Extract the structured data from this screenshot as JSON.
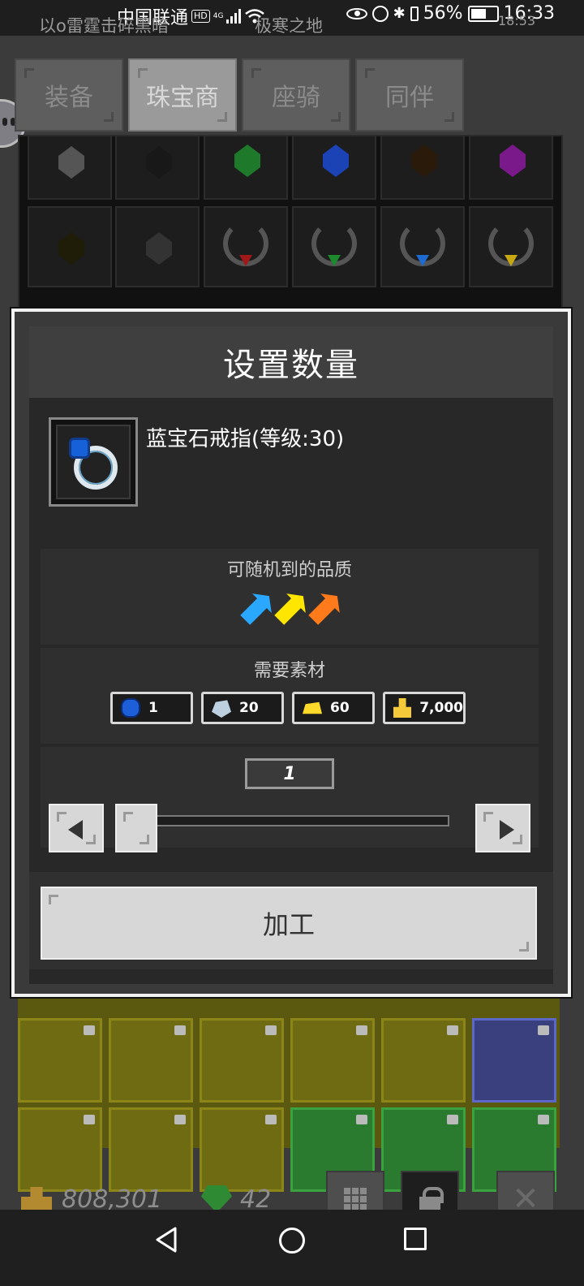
{
  "status_bar": {
    "carrier": "中国联通",
    "hd": "HD",
    "network": "4G",
    "battery": "56%",
    "time": "16:33"
  },
  "background_header": {
    "left_text": "以o雷霆击碎黑暗",
    "mid_text": "极寒之地",
    "right_text": "18:53"
  },
  "tabs": [
    {
      "label": "装备"
    },
    {
      "label": "珠宝商"
    },
    {
      "label": "座骑"
    },
    {
      "label": "同伴"
    }
  ],
  "dialog": {
    "title": "设置数量",
    "item_name": "蓝宝石戒指(等级:30)",
    "quality_title": "可随机到的品质",
    "qualities": [
      "blue-feather-icon",
      "yellow-feather-icon",
      "orange-feather-icon"
    ],
    "materials_title": "需要素材",
    "materials": [
      {
        "icon": "sapphire-icon",
        "amount": "1"
      },
      {
        "icon": "silver-ore-icon",
        "amount": "20"
      },
      {
        "icon": "gold-ore-icon",
        "amount": "60"
      },
      {
        "icon": "gold-bars-icon",
        "amount": "7,000"
      }
    ],
    "quantity": "1",
    "slider_level": 0.0,
    "craft_label": "加工"
  },
  "bottom_bar": {
    "gold": "808,301",
    "gems": "42"
  },
  "colors": {
    "dialog_border": "#f2f2f2",
    "button_bg": "#d7d7d7",
    "quality_blue": "#2aa8ff",
    "quality_yellow": "#ffe600",
    "quality_orange": "#ff7a1a"
  }
}
